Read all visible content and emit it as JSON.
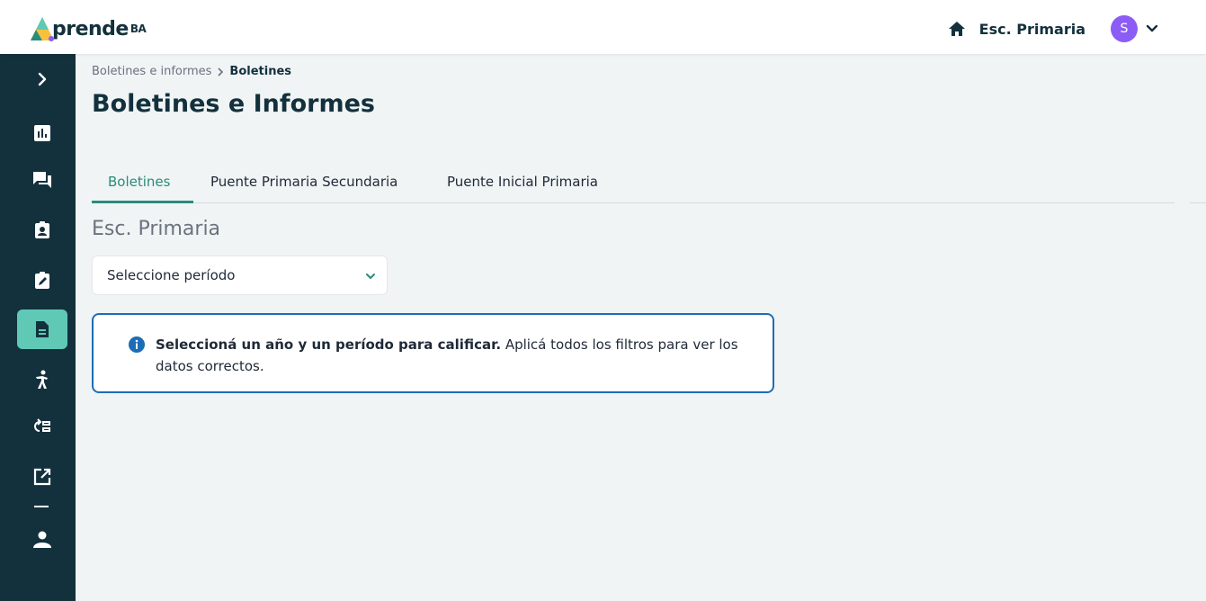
{
  "header": {
    "logo_text": "prende",
    "logo_suffix": "BA",
    "school": "Esc. Primaria",
    "avatar_initial": "S",
    "avatar_color": "#8b5cf6"
  },
  "sidebar": {
    "items": [
      {
        "icon": "chevron-right-icon"
      },
      {
        "icon": "bar-chart-icon"
      },
      {
        "icon": "chat-icon"
      },
      {
        "icon": "id-badge-icon"
      },
      {
        "icon": "clipboard-edit-icon"
      },
      {
        "icon": "document-icon",
        "active": true
      },
      {
        "icon": "person-walking-icon"
      },
      {
        "icon": "swap-list-icon"
      },
      {
        "icon": "external-link-icon"
      },
      {
        "icon": "user-icon"
      }
    ],
    "active_color": "#5fc9b5",
    "bg_color": "#13313d"
  },
  "breadcrumb": {
    "parent": "Boletines e informes",
    "current": "Boletines"
  },
  "page_title": "Boletines e Informes",
  "tabs": [
    {
      "label": "Boletines",
      "active": true
    },
    {
      "label": "Puente Primaria Secundaria"
    },
    {
      "label": "Puente Inicial Primaria"
    }
  ],
  "section_title": "Esc. Primaria",
  "period_select": {
    "value": "Seleccione período"
  },
  "alert": {
    "bold": "Seleccioná un año y un período para calificar.",
    "text": " Aplicá todos los filtros para ver los datos correctos.",
    "border_color": "#1c6db5"
  }
}
